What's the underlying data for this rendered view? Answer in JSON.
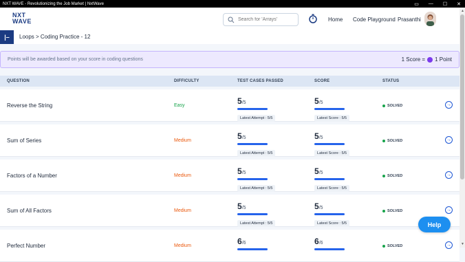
{
  "window": {
    "title": "NXT WAVE - Revolutionizing the Job Market | NxtWave"
  },
  "header": {
    "logo_line1": "NXT",
    "logo_line2": "WAVE",
    "search_placeholder": "Search for 'Arrays'",
    "nav_home": "Home",
    "nav_code_playground": "Code Playground",
    "user_name": "Prasanthi"
  },
  "breadcrumb": {
    "text": "Loops > Coding Practice - 12"
  },
  "banner": {
    "message": "Points will be awarded based on your score in coding questions",
    "points_left": "1 Score =",
    "points_right": "1 Point"
  },
  "table": {
    "headers": [
      "QUESTION",
      "DIFFICULTY",
      "TEST CASES PASSED",
      "SCORE",
      "STATUS"
    ],
    "rows": [
      {
        "question": "Reverse the String",
        "difficulty": "Easy",
        "tc_passed": "5",
        "tc_total": "/5",
        "tc_attempt": "Latest Attempt : 5/5",
        "score": "5",
        "score_total": "/5",
        "score_latest": "Latest Score : 5/5",
        "status": "SOLVED",
        "progress": 1.0
      },
      {
        "question": "Sum of Series",
        "difficulty": "Medium",
        "tc_passed": "5",
        "tc_total": "/5",
        "tc_attempt": "Latest Attempt : 5/5",
        "score": "5",
        "score_total": "/5",
        "score_latest": "Latest Score : 5/5",
        "status": "SOLVED",
        "progress": 1.0
      },
      {
        "question": "Factors of a Number",
        "difficulty": "Medium",
        "tc_passed": "5",
        "tc_total": "/5",
        "tc_attempt": "Latest Attempt : 5/5",
        "score": "5",
        "score_total": "/5",
        "score_latest": "Latest Score : 5/5",
        "status": "SOLVED",
        "progress": 1.0
      },
      {
        "question": "Sum of All Factors",
        "difficulty": "Medium",
        "tc_passed": "5",
        "tc_total": "/5",
        "tc_attempt": "Latest Attempt : 5/5",
        "score": "5",
        "score_total": "/5",
        "score_latest": "Latest Score : 5/5",
        "status": "SOLVED",
        "progress": 1.0
      },
      {
        "question": "Perfect Number",
        "difficulty": "Medium",
        "tc_passed": "6",
        "tc_total": "/6",
        "tc_attempt": "",
        "score": "6",
        "score_total": "/6",
        "score_latest": "",
        "status": "SOLVED",
        "progress": 1.0
      }
    ]
  },
  "help_label": "Help",
  "colors": {
    "easy": "#16a34a",
    "medium": "#ea580c",
    "brand": "#1b3b82",
    "accent": "#2563eb"
  },
  "icons": [
    "search-icon",
    "timer-icon",
    "sidebar-toggle-icon",
    "arrow-right-circle-icon",
    "coin-icon"
  ]
}
